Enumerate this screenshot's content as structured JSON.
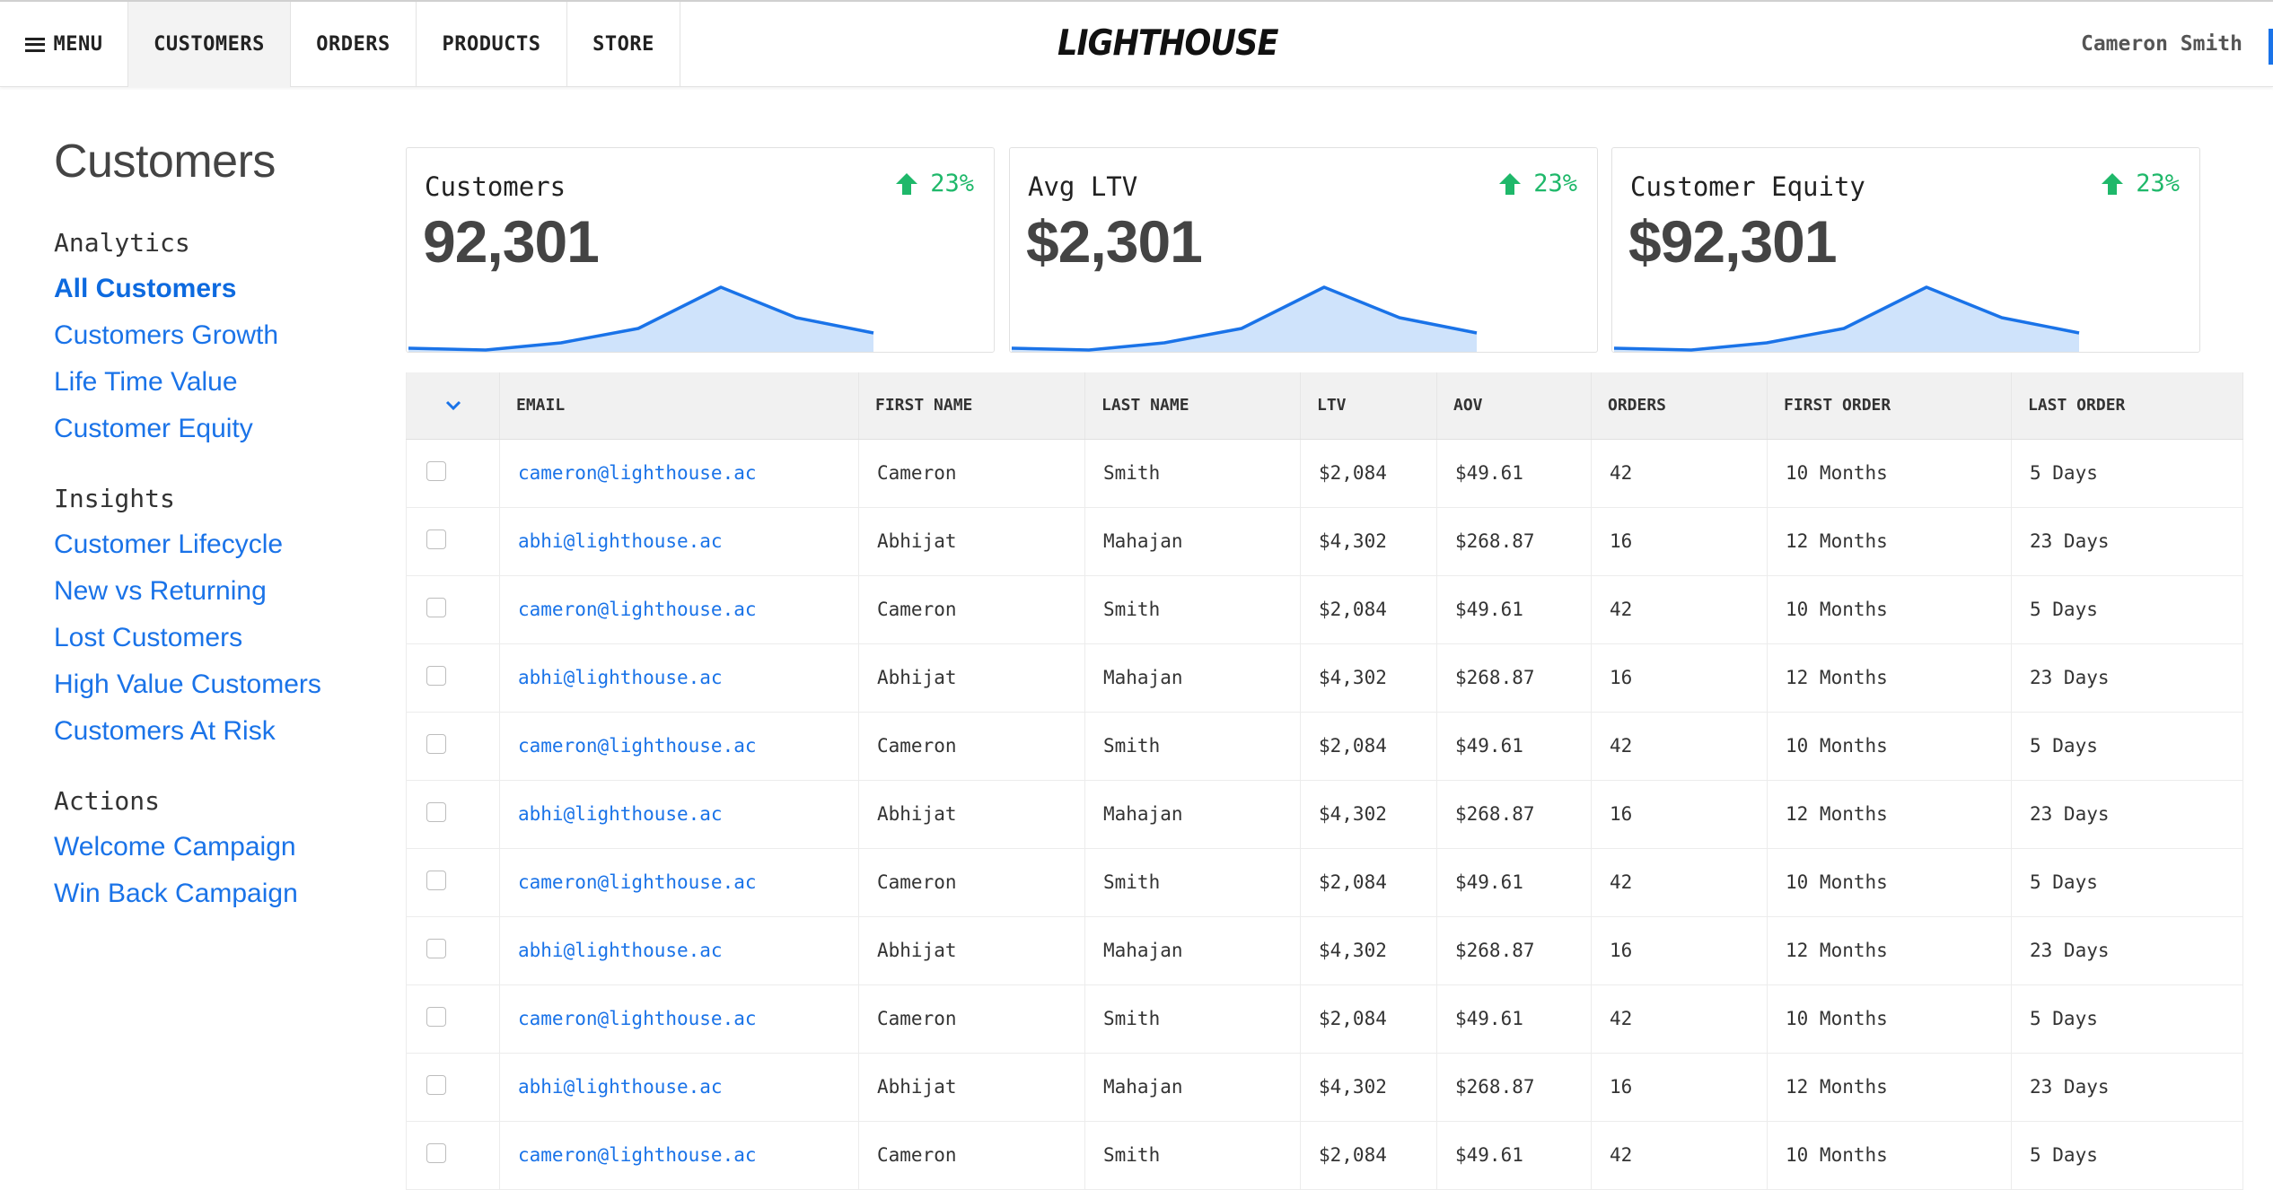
{
  "nav": {
    "menu_label": "MENU",
    "tabs": [
      {
        "label": "CUSTOMERS",
        "active": true
      },
      {
        "label": "ORDERS",
        "active": false
      },
      {
        "label": "PRODUCTS",
        "active": false
      },
      {
        "label": "STORE",
        "active": false
      }
    ],
    "logo": "LIGHTHOUSE",
    "user": "Cameron Smith"
  },
  "sidebar": {
    "title": "Customers",
    "sections": [
      {
        "title": "Analytics",
        "items": [
          "All Customers",
          "Customers Growth",
          "Life Time Value",
          "Customer Equity"
        ]
      },
      {
        "title": "Insights",
        "items": [
          "Customer Lifecycle",
          "New vs Returning",
          "Lost Customers",
          "High Value Customers",
          "Customers At Risk"
        ]
      },
      {
        "title": "Actions",
        "items": [
          "Welcome Campaign",
          "Win Back Campaign"
        ]
      }
    ],
    "active_item": "All Customers"
  },
  "cards": [
    {
      "label": "Customers",
      "value": "92,301",
      "change": "23%"
    },
    {
      "label": "Avg LTV",
      "value": "$2,301",
      "change": "23%"
    },
    {
      "label": "Customer Equity",
      "value": "$92,301",
      "change": "23%"
    }
  ],
  "colors": {
    "accent": "#1a73e8",
    "positive": "#1fb86a",
    "spark_fill": "#cfe3fb"
  },
  "table": {
    "columns": [
      "EMAIL",
      "FIRST NAME",
      "LAST NAME",
      "LTV",
      "AOV",
      "ORDERS",
      "FIRST ORDER",
      "LAST ORDER"
    ],
    "rows": [
      [
        "cameron@lighthouse.ac",
        "Cameron",
        "Smith",
        "$2,084",
        "$49.61",
        "42",
        "10 Months",
        "5 Days"
      ],
      [
        "abhi@lighthouse.ac",
        "Abhijat",
        "Mahajan",
        "$4,302",
        "$268.87",
        "16",
        "12 Months",
        "23 Days"
      ],
      [
        "cameron@lighthouse.ac",
        "Cameron",
        "Smith",
        "$2,084",
        "$49.61",
        "42",
        "10 Months",
        "5 Days"
      ],
      [
        "abhi@lighthouse.ac",
        "Abhijat",
        "Mahajan",
        "$4,302",
        "$268.87",
        "16",
        "12 Months",
        "23 Days"
      ],
      [
        "cameron@lighthouse.ac",
        "Cameron",
        "Smith",
        "$2,084",
        "$49.61",
        "42",
        "10 Months",
        "5 Days"
      ],
      [
        "abhi@lighthouse.ac",
        "Abhijat",
        "Mahajan",
        "$4,302",
        "$268.87",
        "16",
        "12 Months",
        "23 Days"
      ],
      [
        "cameron@lighthouse.ac",
        "Cameron",
        "Smith",
        "$2,084",
        "$49.61",
        "42",
        "10 Months",
        "5 Days"
      ],
      [
        "abhi@lighthouse.ac",
        "Abhijat",
        "Mahajan",
        "$4,302",
        "$268.87",
        "16",
        "12 Months",
        "23 Days"
      ],
      [
        "cameron@lighthouse.ac",
        "Cameron",
        "Smith",
        "$2,084",
        "$49.61",
        "42",
        "10 Months",
        "5 Days"
      ],
      [
        "abhi@lighthouse.ac",
        "Abhijat",
        "Mahajan",
        "$4,302",
        "$268.87",
        "16",
        "12 Months",
        "23 Days"
      ],
      [
        "cameron@lighthouse.ac",
        "Cameron",
        "Smith",
        "$2,084",
        "$49.61",
        "42",
        "10 Months",
        "5 Days"
      ]
    ]
  }
}
